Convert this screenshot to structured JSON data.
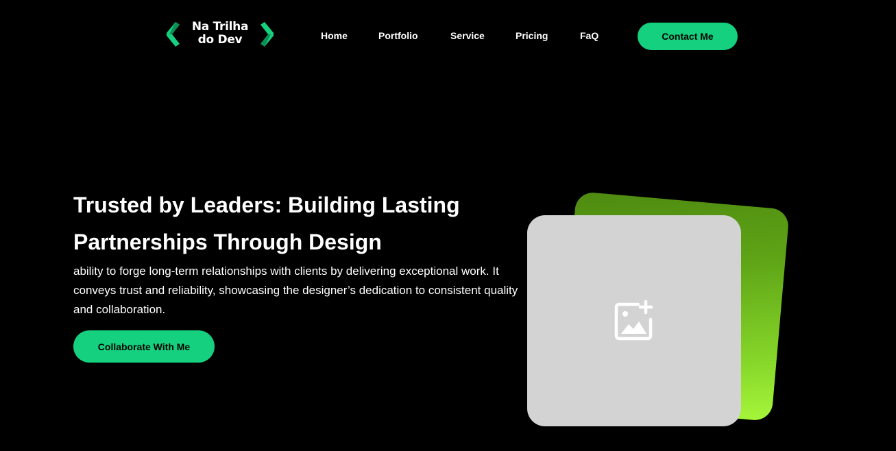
{
  "header": {
    "logo": {
      "line1": "Na Trilha",
      "line2": "do Dev",
      "icon_left": "chevron-left-icon",
      "icon_right": "chevron-right-icon",
      "accent_color": "#15d17f"
    },
    "nav": [
      {
        "label": "Home"
      },
      {
        "label": "Portfolio"
      },
      {
        "label": "Service"
      },
      {
        "label": "Pricing"
      },
      {
        "label": "FaQ"
      }
    ],
    "contact_label": "Contact Me"
  },
  "hero": {
    "title": "Trusted by Leaders: Building Lasting Partnerships Through Design",
    "description": "ability to forge long-term relationships with clients by delivering exceptional work. It conveys trust and reliability, showcasing the designer’s dedication to consistent quality and collaboration.",
    "cta_label": "Collaborate With Me",
    "image_placeholder_icon": "add-image-icon"
  },
  "colors": {
    "background": "#000000",
    "accent": "#15d17f",
    "card_gradient_top": "#4e8a10",
    "card_gradient_bottom": "#a6f73a",
    "placeholder": "#d3d3d3"
  }
}
